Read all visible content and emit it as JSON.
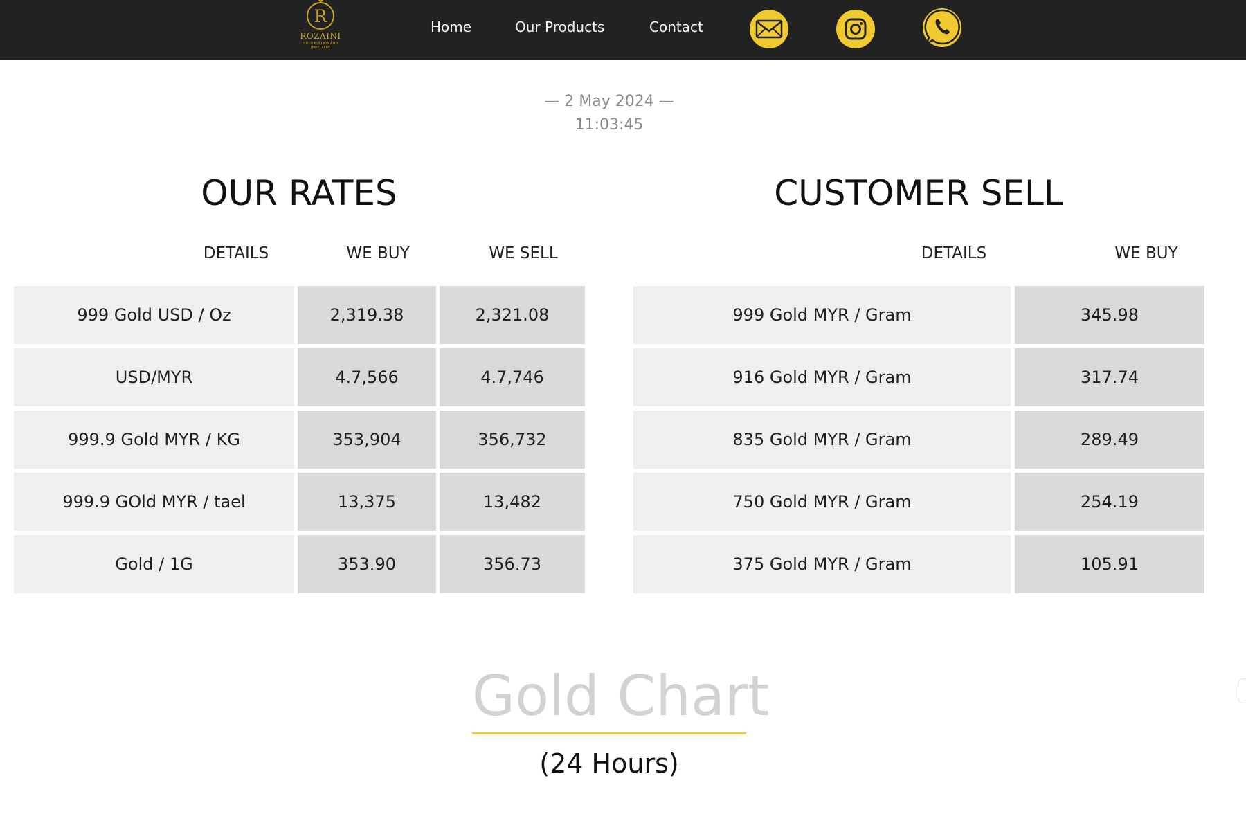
{
  "brand": {
    "logo_letter": "R",
    "name": "ROZAINI",
    "tagline": "GOLD BULLION AND JEWELLERY",
    "accent_color": "#f0c92e",
    "gold_color": "#c8a227"
  },
  "nav": {
    "links": [
      "Home",
      "Our Products",
      "Contact"
    ],
    "social": [
      {
        "icon": "envelope-icon"
      },
      {
        "icon": "instagram-icon"
      },
      {
        "icon": "whatsapp-icon"
      }
    ]
  },
  "datetime": {
    "date": "— 2 May 2024 —",
    "time": "11:03:45"
  },
  "our_rates": {
    "title": "OUR RATES",
    "headers": [
      "DETAILS",
      "WE BUY",
      "WE SELL"
    ],
    "rows": [
      {
        "details": "999 Gold USD / Oz",
        "buy": "2,319.38",
        "sell": "2,321.08"
      },
      {
        "details": "USD/MYR",
        "buy": "4.7,566",
        "sell": "4.7,746"
      },
      {
        "details": "999.9 Gold MYR / KG",
        "buy": "353,904",
        "sell": "356,732"
      },
      {
        "details": "999.9 GOld MYR / tael",
        "buy": "13,375",
        "sell": "13,482"
      },
      {
        "details": "Gold / 1G",
        "buy": "353.90",
        "sell": "356.73"
      }
    ]
  },
  "customer_sell": {
    "title": "CUSTOMER SELL",
    "headers": [
      "DETAILS",
      "WE BUY"
    ],
    "rows": [
      {
        "details": "999 Gold MYR / Gram",
        "buy": "345.98"
      },
      {
        "details": "916 Gold MYR / Gram",
        "buy": "317.74"
      },
      {
        "details": "835 Gold MYR / Gram",
        "buy": "289.49"
      },
      {
        "details": "750 Gold MYR / Gram",
        "buy": "254.19"
      },
      {
        "details": "375 Gold MYR / Gram",
        "buy": "105.91"
      }
    ]
  },
  "gold_chart": {
    "title": "Gold Chart",
    "subtitle": "(24 Hours)"
  }
}
